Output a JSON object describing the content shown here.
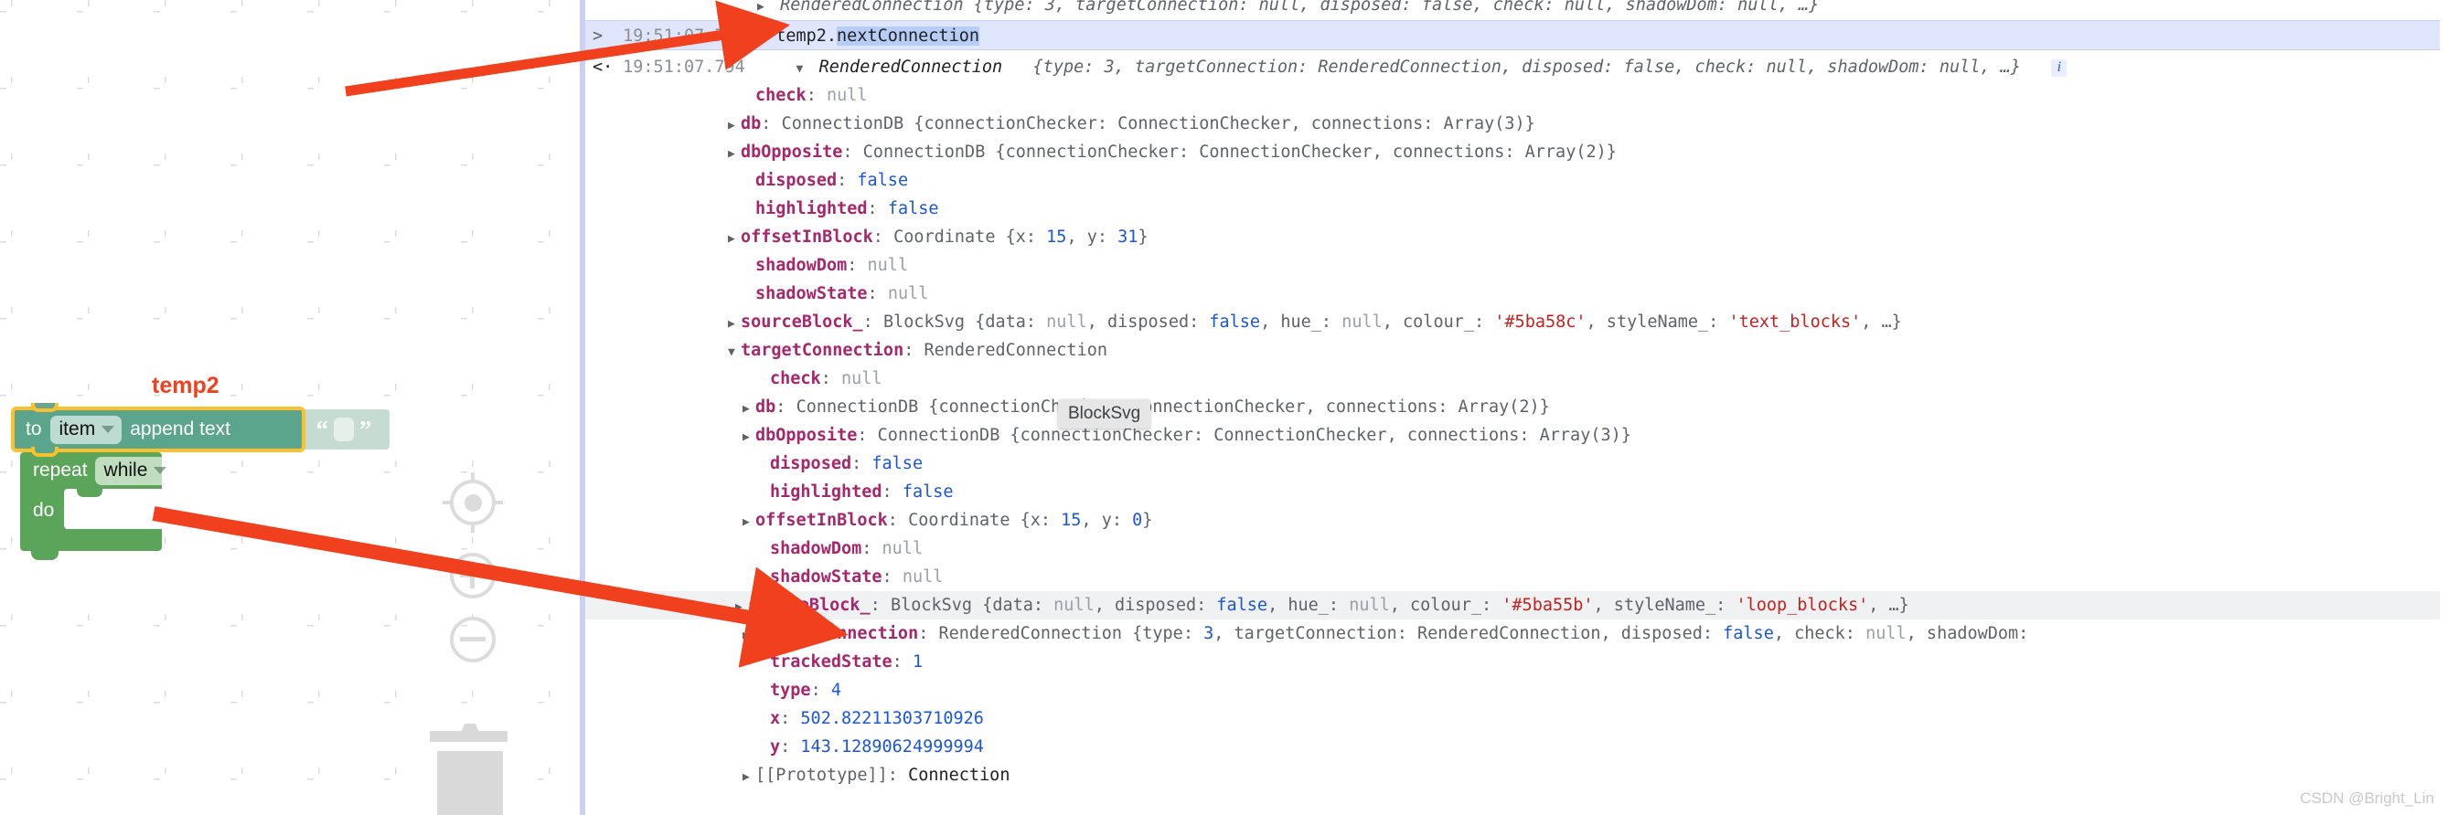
{
  "workspace": {
    "selected_block_label": "temp2",
    "blocks": {
      "append": {
        "prefix": "to",
        "variable": "item",
        "action": "append text"
      },
      "loop": {
        "prefix": "repeat",
        "mode": "while",
        "body_label": "do"
      }
    },
    "controls": {
      "center_icon": "target-crosshair-icon",
      "zoom_in_icon": "plus-icon",
      "zoom_out_icon": "minus-icon",
      "trash_icon": "trash-can-icon"
    }
  },
  "console": {
    "cut_off_top_line": "RenderedConnection {type: 3, targetConnection: null, disposed: false, check: null, shadowDom: null, …}",
    "command": {
      "caret": ">",
      "timestamp": "19:51:07.781",
      "text_prefix": "temp2.",
      "text_selected": "nextConnection"
    },
    "result": {
      "caret": "<·",
      "timestamp": "19:51:07.794",
      "header": {
        "ctor": "RenderedConnection",
        "preview": "{type: 3, targetConnection: RenderedConnection, disposed: false, check: null, shadowDom: null, …}",
        "info_badge": "i"
      }
    },
    "rows": [
      {
        "indent": 2,
        "tri": "blank",
        "name": "check",
        "value": "null",
        "vtype": "null"
      },
      {
        "indent": 1,
        "tri": "closed",
        "name": "db",
        "ctor": "ConnectionDB",
        "preview": "{connectionChecker: ConnectionChecker, connections: Array(3)}"
      },
      {
        "indent": 1,
        "tri": "closed",
        "name": "dbOpposite",
        "ctor": "ConnectionDB",
        "preview": "{connectionChecker: ConnectionChecker, connections: Array(2)}"
      },
      {
        "indent": 2,
        "tri": "blank",
        "name": "disposed",
        "value": "false",
        "vtype": "bool"
      },
      {
        "indent": 2,
        "tri": "blank",
        "name": "highlighted",
        "value": "false",
        "vtype": "bool"
      },
      {
        "indent": 1,
        "tri": "closed",
        "name": "offsetInBlock",
        "ctor": "Coordinate",
        "preview": "{x: 15, y: 31}"
      },
      {
        "indent": 2,
        "tri": "blank",
        "name": "shadowDom",
        "value": "null",
        "vtype": "null"
      },
      {
        "indent": 2,
        "tri": "blank",
        "name": "shadowState",
        "value": "null",
        "vtype": "null"
      },
      {
        "indent": 1,
        "tri": "closed",
        "name": "sourceBlock_",
        "ctor": "BlockSvg",
        "preview": "{data: null, disposed: false, hue_: null, colour_: '#5ba58c', styleName_: 'text_blocks', …}"
      },
      {
        "indent": 1,
        "tri": "open",
        "name": "targetConnection",
        "ctor": "RenderedConnection"
      },
      {
        "indent": 3,
        "tri": "blank",
        "name": "check",
        "value": "null",
        "vtype": "null"
      },
      {
        "indent": 2,
        "tri": "closed",
        "name": "db",
        "ctor": "ConnectionDB",
        "preview": "{connectionChecker: ConnectionChecker, connections: Array(2)}"
      },
      {
        "indent": 2,
        "tri": "closed",
        "name": "dbOpposite",
        "ctor": "ConnectionDB",
        "preview": "{connectionChecker: ConnectionChecker, connections: Array(3)}"
      },
      {
        "indent": 3,
        "tri": "blank",
        "name": "disposed",
        "value": "false",
        "vtype": "bool"
      },
      {
        "indent": 3,
        "tri": "blank",
        "name": "highlighted",
        "value": "false",
        "vtype": "bool"
      },
      {
        "indent": 2,
        "tri": "closed",
        "name": "offsetInBlock",
        "ctor": "Coordinate",
        "preview": "{x: 15, y: 0}"
      },
      {
        "indent": 3,
        "tri": "blank",
        "name": "shadowDom",
        "value": "null",
        "vtype": "null"
      },
      {
        "indent": 3,
        "tri": "blank",
        "name": "shadowState",
        "value": "null",
        "vtype": "null"
      },
      {
        "indent": 2,
        "tri": "closed",
        "name": "sourceBlock_",
        "ctor": "BlockSvg",
        "preview": "{data: null, disposed: false, hue_: null, colour_: '#5ba55b', styleName_: 'loop_blocks', …}",
        "highlighted": true
      },
      {
        "indent": 2,
        "tri": "closed",
        "name": "targetConnection",
        "ctor": "RenderedConnection",
        "preview": "{type: 3, targetConnection: RenderedConnection, disposed: false, check: null, shadowDom:"
      },
      {
        "indent": 3,
        "tri": "blank",
        "name": "trackedState",
        "value": "1",
        "vtype": "num"
      },
      {
        "indent": 3,
        "tri": "blank",
        "name": "type",
        "value": "4",
        "vtype": "num"
      },
      {
        "indent": 3,
        "tri": "blank",
        "name": "x",
        "value": "502.82211303710926",
        "vtype": "num"
      },
      {
        "indent": 3,
        "tri": "blank",
        "name": "y",
        "value": "143.12890624999994",
        "vtype": "num"
      },
      {
        "indent": 2,
        "tri": "closed",
        "name": "[[Prototype]]",
        "ctor": "Connection",
        "proto": true
      }
    ],
    "tooltip": "BlockSvg",
    "watermark": "CSDN @Bright_Lin"
  },
  "colors": {
    "selection_ring": "#fbc02d",
    "text_block": "#5ba58c",
    "loop_block": "#5ba55b",
    "arrow": "#f1401e",
    "command_row_bg": "#dfe6fb",
    "property_name": "#a6276c",
    "string_value": "#c5221f",
    "number_value": "#1a56db"
  }
}
